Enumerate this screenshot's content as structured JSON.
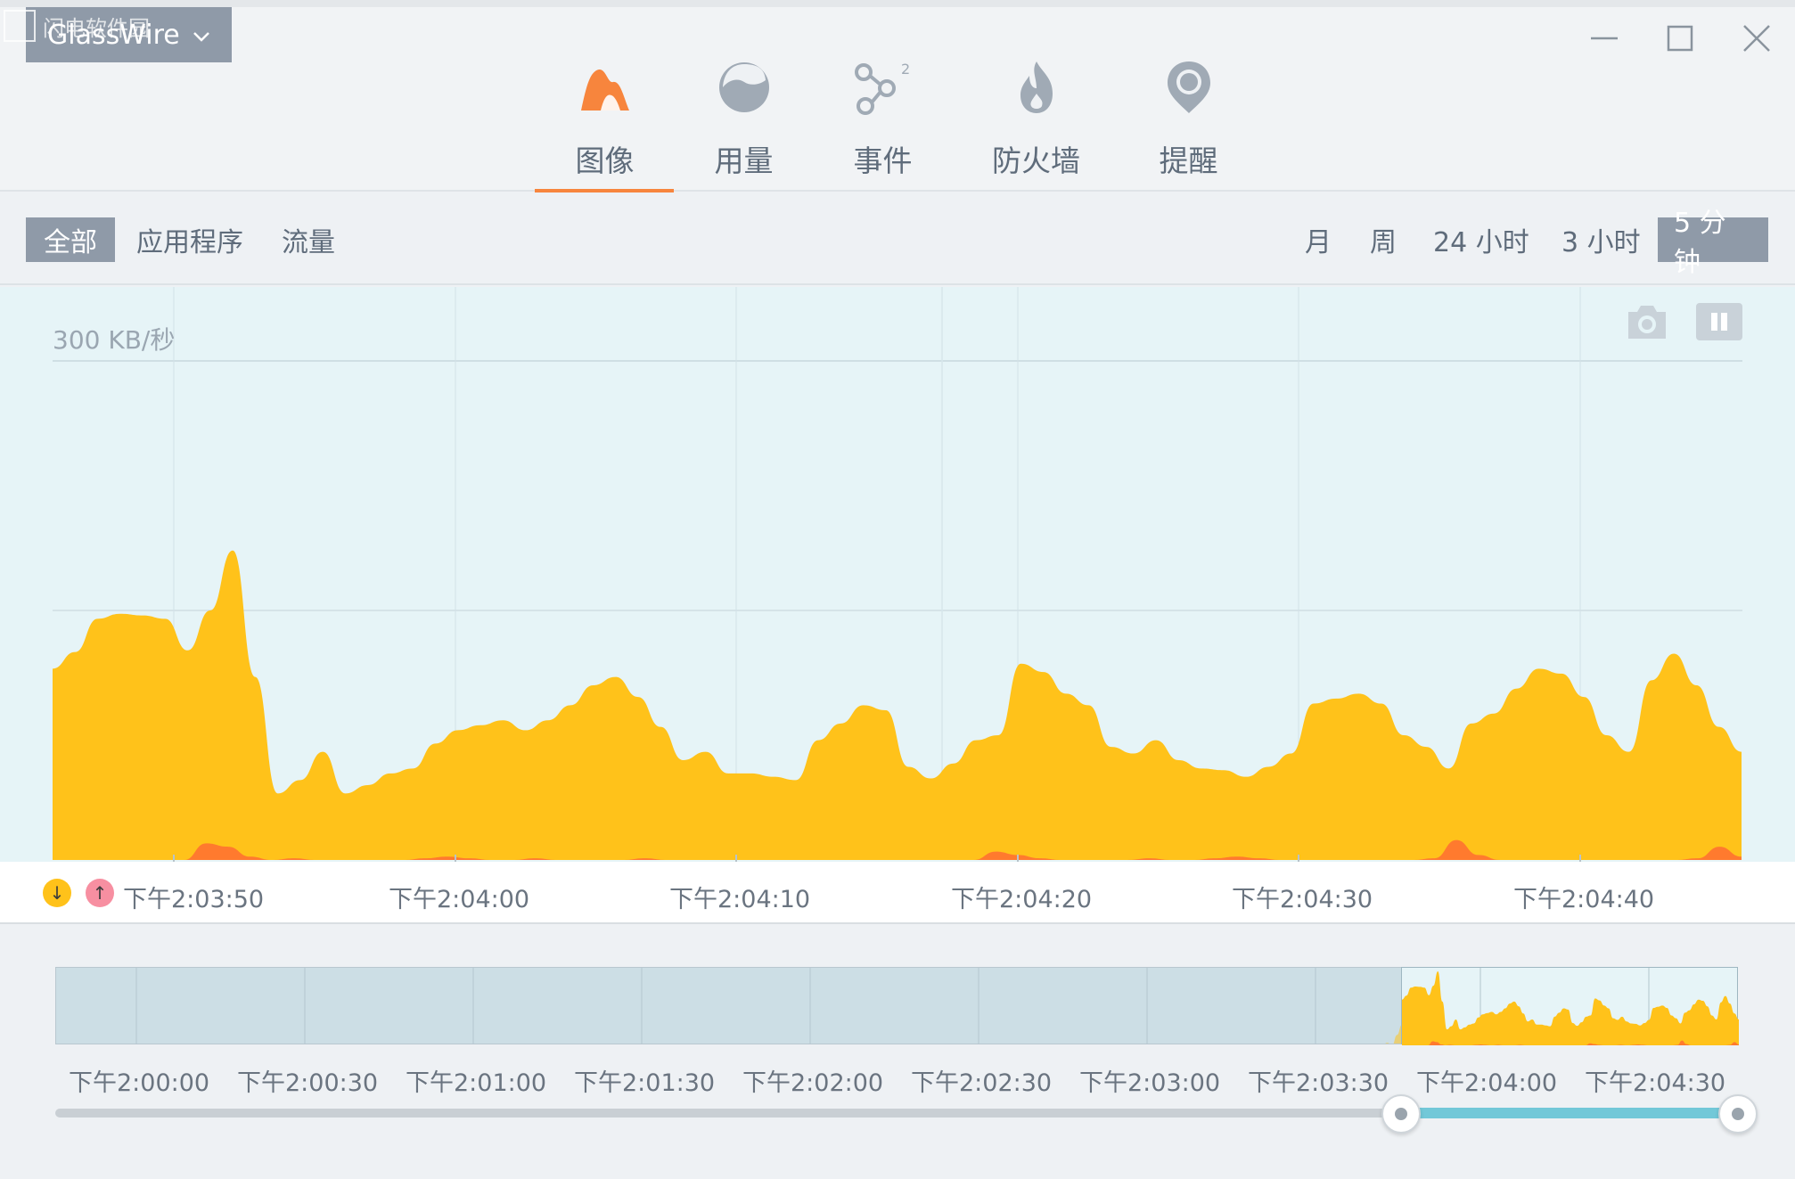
{
  "app": {
    "title": "GlassWire",
    "watermark": "闪电软件园"
  },
  "nav": {
    "tabs": [
      {
        "label": "图像",
        "icon": "graph-icon",
        "active": true
      },
      {
        "label": "用量",
        "icon": "usage-icon",
        "active": false
      },
      {
        "label": "事件",
        "icon": "events-icon",
        "active": false,
        "badge": "2"
      },
      {
        "label": "防火墙",
        "icon": "firewall-icon",
        "active": false
      },
      {
        "label": "提醒",
        "icon": "alerts-icon",
        "active": false
      }
    ]
  },
  "filters": {
    "view": [
      "全部",
      "应用程序",
      "流量"
    ],
    "view_selected": "全部",
    "ranges": [
      "月",
      "周",
      "24 小时",
      "3 小时",
      "5 分钟"
    ],
    "range_selected": "5 分钟"
  },
  "graph": {
    "ylabel": "300 KB/秒",
    "time_labels": [
      "下午2:03:50",
      "下午2:04:00",
      "下午2:04:10",
      "下午2:04:20",
      "下午2:04:30",
      "下午2:04:40"
    ],
    "legend": {
      "download": "↓",
      "upload": "↑"
    },
    "colors": {
      "download": "#ffc21a",
      "upload": "#ff7a2e",
      "background": "#e6f4f7"
    }
  },
  "overview": {
    "time_labels": [
      "下午2:00:00",
      "下午2:00:30",
      "下午2:01:00",
      "下午2:01:30",
      "下午2:02:00",
      "下午2:02:30",
      "下午2:03:00",
      "下午2:03:30",
      "下午2:04:00",
      "下午2:04:30"
    ],
    "selection_start": 0.8,
    "selection_end": 1.0
  },
  "chart_data": {
    "type": "area",
    "ylim": [
      0,
      300
    ],
    "yunit": "KB/秒",
    "series": [
      {
        "name": "download",
        "values": [
          115,
          125,
          145,
          148,
          147,
          145,
          126,
          150,
          186,
          110,
          40,
          48,
          65,
          40,
          45,
          52,
          55,
          70,
          78,
          81,
          84,
          78,
          84,
          93,
          105,
          110,
          98,
          80,
          60,
          65,
          52,
          52,
          50,
          48,
          72,
          82,
          93,
          90,
          56,
          49,
          58,
          72,
          75,
          118,
          113,
          100,
          93,
          68,
          64,
          72,
          60,
          55,
          54,
          50,
          56,
          64,
          94,
          97,
          100,
          94,
          75,
          68,
          55,
          82,
          88,
          103,
          115,
          112,
          98,
          75,
          65,
          108,
          124,
          105,
          80,
          65
        ]
      },
      {
        "name": "upload",
        "values": [
          0,
          0,
          0,
          0,
          0,
          0,
          0,
          10,
          8,
          2,
          0,
          1,
          0,
          0,
          0,
          0,
          0,
          1,
          2,
          1,
          0,
          0,
          1,
          0,
          0,
          0,
          0,
          1,
          0,
          0,
          0,
          0,
          0,
          0,
          0,
          0,
          0,
          0,
          0,
          0,
          0,
          0,
          0,
          5,
          3,
          1,
          0,
          0,
          0,
          0,
          1,
          0,
          0,
          1,
          2,
          1,
          0,
          0,
          0,
          0,
          0,
          0,
          0,
          1,
          12,
          3,
          0,
          0,
          0,
          0,
          0,
          0,
          0,
          0,
          0,
          1,
          8,
          2
        ]
      }
    ]
  }
}
